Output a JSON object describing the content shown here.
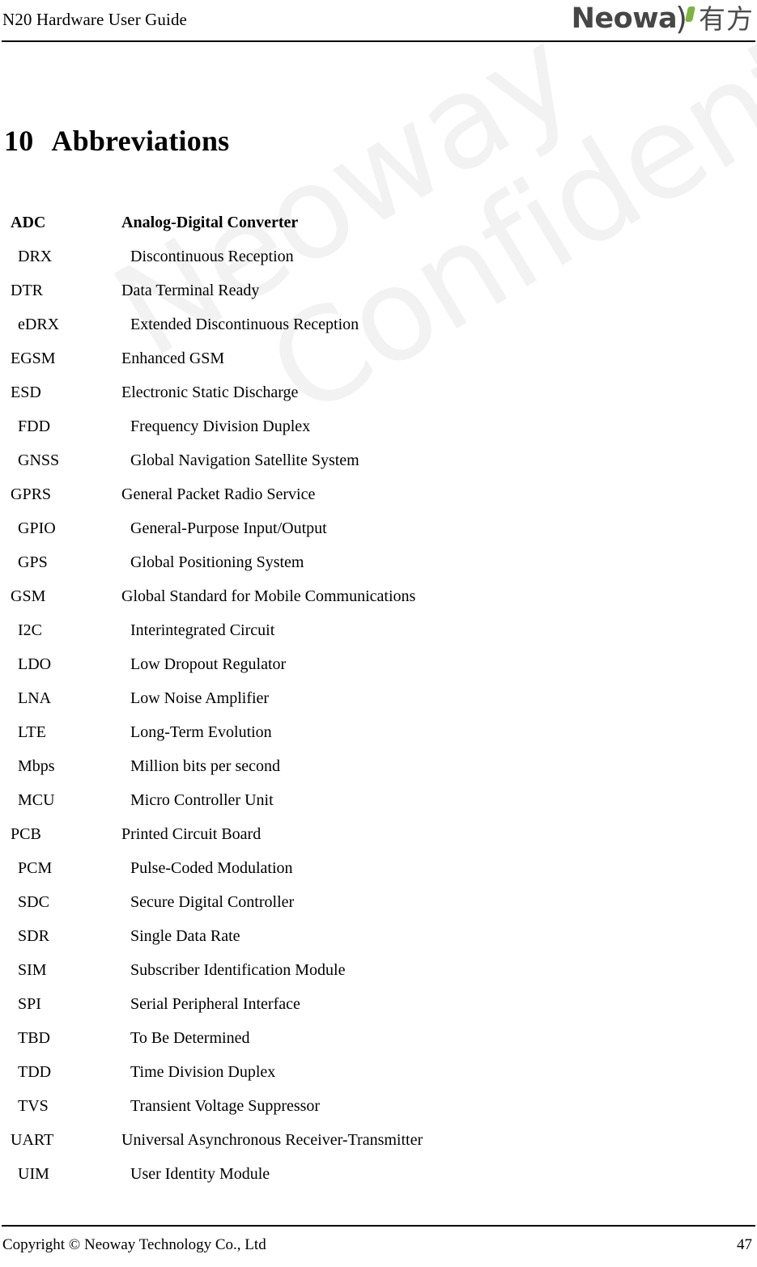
{
  "header": {
    "document_title": "N20 Hardware User Guide",
    "logo": {
      "wordmark": "Neowa",
      "paren_glyph": ")",
      "cjk": "有方",
      "accent_color": "#7cb342",
      "text_color": "#464646"
    }
  },
  "watermark": {
    "line1": "Neoway",
    "line2": "Confidential",
    "color": "#f2f2f2"
  },
  "chapter": {
    "number": "10",
    "title": "Abbreviations"
  },
  "abbreviations": [
    {
      "term": "ADC",
      "definition": "Analog-Digital Converter",
      "indent": "a",
      "bold": true
    },
    {
      "term": "DRX",
      "definition": "Discontinuous Reception",
      "indent": "b",
      "bold": false
    },
    {
      "term": "DTR",
      "definition": "Data Terminal Ready",
      "indent": "a",
      "bold": false
    },
    {
      "term": "eDRX",
      "definition": "Extended Discontinuous Reception",
      "indent": "b",
      "bold": false
    },
    {
      "term": "EGSM",
      "definition": "Enhanced GSM",
      "indent": "a",
      "bold": false
    },
    {
      "term": "ESD",
      "definition": "Electronic Static Discharge",
      "indent": "a",
      "bold": false
    },
    {
      "term": "FDD",
      "definition": "Frequency Division Duplex",
      "indent": "b",
      "bold": false
    },
    {
      "term": "GNSS",
      "definition": "Global Navigation Satellite System",
      "indent": "b",
      "bold": false
    },
    {
      "term": "GPRS",
      "definition": "General Packet Radio Service",
      "indent": "a",
      "bold": false
    },
    {
      "term": "GPIO",
      "definition": "General-Purpose Input/Output",
      "indent": "b",
      "bold": false
    },
    {
      "term": "GPS",
      "definition": "Global Positioning System",
      "indent": "b",
      "bold": false
    },
    {
      "term": "GSM",
      "definition": "Global Standard for Mobile Communications",
      "indent": "a",
      "bold": false
    },
    {
      "term": "I2C",
      "definition": "Interintegrated Circuit",
      "indent": "b",
      "bold": false
    },
    {
      "term": "LDO",
      "definition": "Low Dropout Regulator",
      "indent": "b",
      "bold": false
    },
    {
      "term": "LNA",
      "definition": "Low Noise Amplifier",
      "indent": "b",
      "bold": false
    },
    {
      "term": "LTE",
      "definition": "Long-Term Evolution",
      "indent": "b",
      "bold": false
    },
    {
      "term": "Mbps",
      "definition": "Million bits per second",
      "indent": "b",
      "bold": false
    },
    {
      "term": "MCU",
      "definition": "Micro Controller Unit",
      "indent": "b",
      "bold": false
    },
    {
      "term": "PCB",
      "definition": "Printed Circuit Board",
      "indent": "a",
      "bold": false
    },
    {
      "term": "PCM",
      "definition": "Pulse-Coded Modulation",
      "indent": "b",
      "bold": false
    },
    {
      "term": "SDC",
      "definition": "Secure Digital Controller",
      "indent": "b",
      "bold": false
    },
    {
      "term": "SDR",
      "definition": "Single Data Rate",
      "indent": "b",
      "bold": false
    },
    {
      "term": "SIM",
      "definition": "Subscriber Identification Module",
      "indent": "b",
      "bold": false
    },
    {
      "term": "SPI",
      "definition": "Serial Peripheral Interface",
      "indent": "b",
      "bold": false
    },
    {
      "term": "TBD",
      "definition": "To Be Determined",
      "indent": "b",
      "bold": false
    },
    {
      "term": "TDD",
      "definition": "Time Division Duplex",
      "indent": "b",
      "bold": false
    },
    {
      "term": "TVS",
      "definition": "Transient Voltage Suppressor",
      "indent": "b",
      "bold": false
    },
    {
      "term": "UART",
      "definition": "Universal Asynchronous Receiver-Transmitter",
      "indent": "a",
      "bold": false
    },
    {
      "term": "UIM",
      "definition": "User Identity Module",
      "indent": "b",
      "bold": false
    }
  ],
  "footer": {
    "copyright": "Copyright © Neoway Technology Co., Ltd",
    "page_number": "47"
  }
}
